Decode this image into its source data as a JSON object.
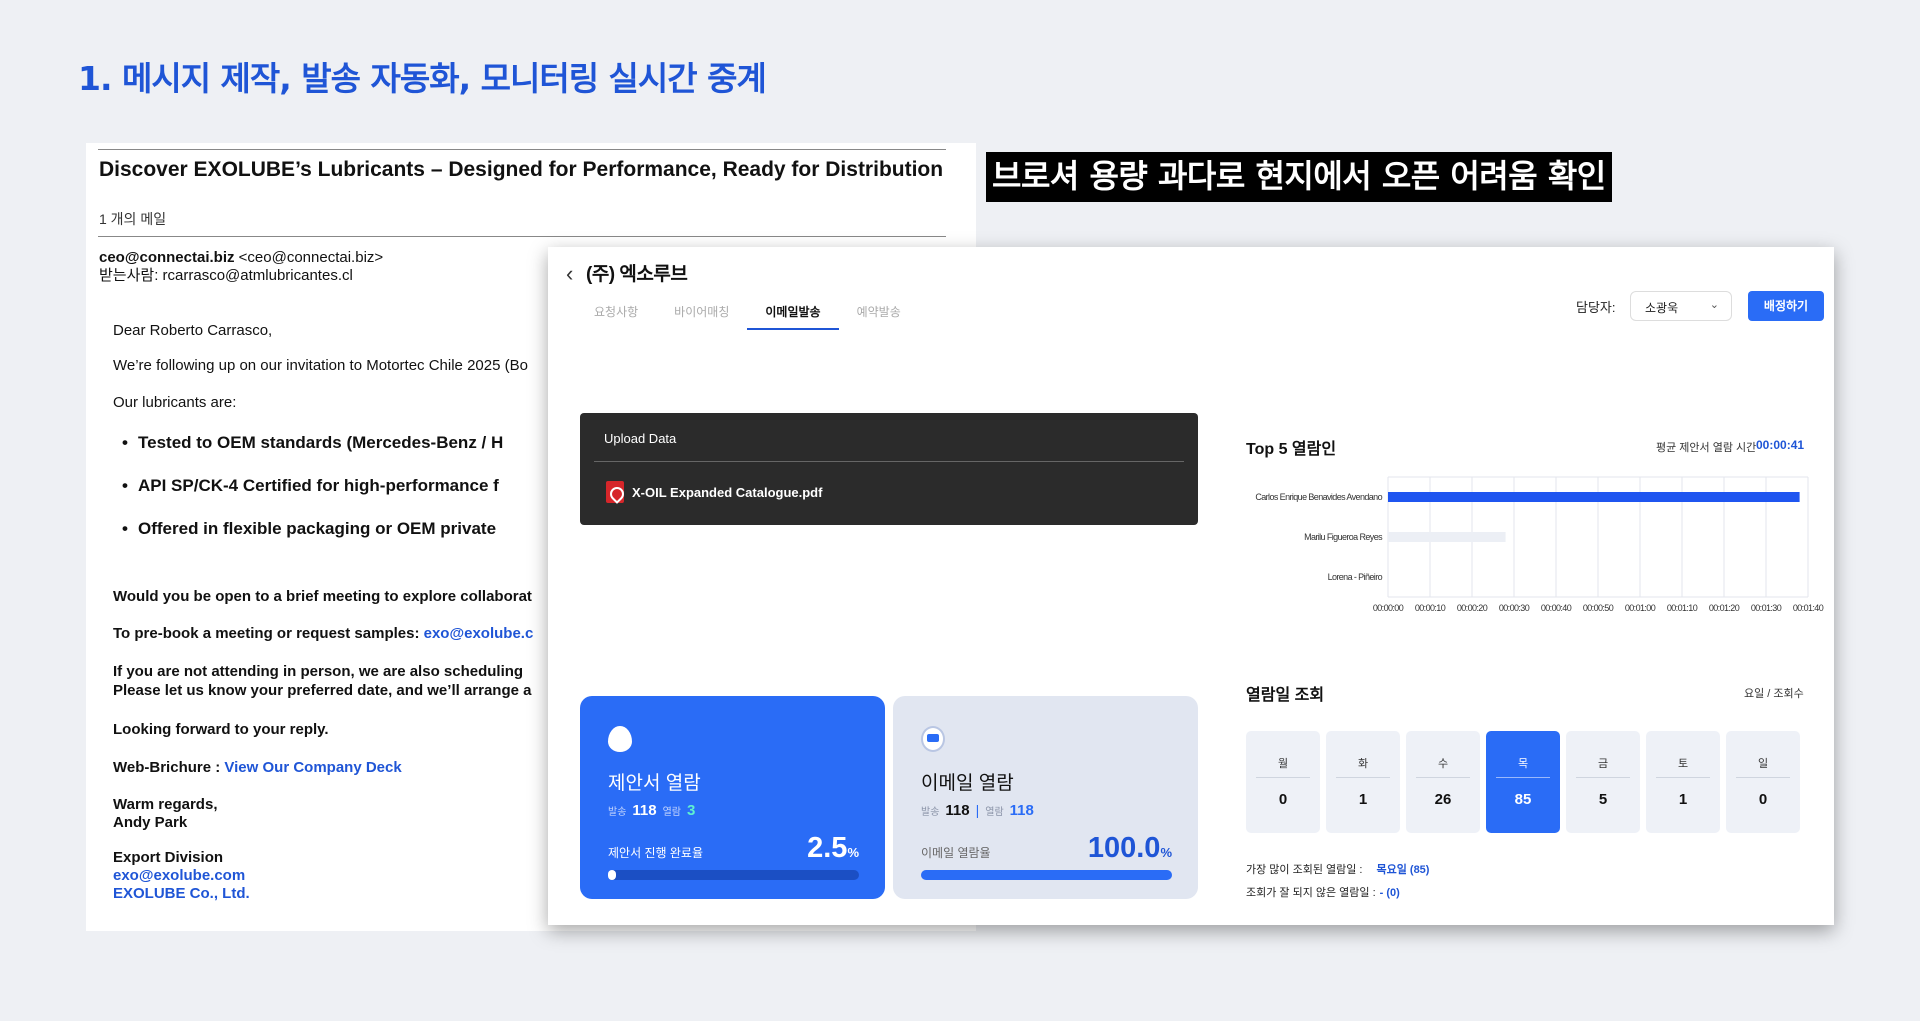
{
  "slide": {
    "title": "1. 메시지 제작, 발송 자동화, 모니터링 실시간 중계",
    "caption": "브로셔 용량 과다로 현지에서 오픈 어려움 확인"
  },
  "email": {
    "subject": "Discover EXOLUBE’s Lubricants – Designed for Performance, Ready for Distribution",
    "count": "1 개의 메일",
    "from_name": "ceo@connectai.biz",
    "from_addr": "<ceo@connectai.biz>",
    "to": "받는사람: rcarrasco@atmlubricantes.cl",
    "greeting": "Dear Roberto Carrasco,",
    "intro": "We’re following up on our invitation to Motortec Chile 2025 (Bo",
    "lead": "Our lubricants are:",
    "bullets": [
      "Tested to OEM standards (Mercedes-Benz / H",
      "API SP/CK-4 Certified for high-performance f",
      "Offered in flexible packaging or OEM private"
    ],
    "q1": "Would you be open to a brief meeting to explore collaborat",
    "q2_label": "To pre-book a meeting or request samples:",
    "q2_link": "exo@exolube.c",
    "q3_line1": "If you are not attending in person, we are also scheduling",
    "q3_line2": "Please let us know your preferred date, and we’ll arrange a",
    "q4": "Looking forward to your reply.",
    "web_label": "Web-Brichure :",
    "web_link": "View Our Company Deck",
    "regards1": "Warm regards,",
    "regards2": "Andy Park",
    "sig_dept": "Export Division",
    "sig_email": "exo@exolube.com",
    "sig_company": "EXOLUBE Co., Ltd."
  },
  "dashboard": {
    "back_icon": "chevron-left-icon",
    "company": "(주) 엑소루브",
    "tabs": [
      "요청사항",
      "바이어매칭",
      "이메일발송",
      "예약발송"
    ],
    "active_tab": 2,
    "assignee_label": "담당자:",
    "assignee_value": "소광욱",
    "assign_button": "배정하기",
    "upload_title": "Upload Data",
    "upload_file": "X-OIL Expanded Catalogue.pdf",
    "top5_title": "Top 5 열람인",
    "avg_label": "평균 제안서 열람 시간",
    "avg_value": "00:00:41",
    "calendar_title": "열람일 조회",
    "calendar_unit": "요일 / 조회수",
    "days": [
      {
        "name": "월",
        "value": "0"
      },
      {
        "name": "화",
        "value": "1"
      },
      {
        "name": "수",
        "value": "26"
      },
      {
        "name": "목",
        "value": "85"
      },
      {
        "name": "금",
        "value": "5"
      },
      {
        "name": "토",
        "value": "1"
      },
      {
        "name": "일",
        "value": "0"
      }
    ],
    "highlight_day": 3,
    "most_viewed_label": "가장 많이 조회된 열람일 :",
    "most_viewed_value": "목요일 (85)",
    "least_viewed_label": "조회가 잘 되지 않은 열람일 :",
    "least_viewed_value": "- (0)",
    "proposal_card": {
      "title": "제안서 열람",
      "sent_label": "발송",
      "sent_value": "118",
      "open_label": "열람",
      "open_value": "3",
      "rate_label": "제안서 진행 완료율",
      "rate_value": "2.5",
      "rate_unit": "%",
      "progress": 2.5
    },
    "email_card": {
      "title": "이메일 열람",
      "sent_label": "발송",
      "sent_value": "118",
      "sep": "|",
      "open_label": "열람",
      "open_value": "118",
      "rate_label": "이메일 열람율",
      "rate_value": "100.0",
      "rate_unit": "%",
      "progress": 100
    }
  },
  "chart_data": {
    "type": "bar",
    "orientation": "horizontal",
    "categories": [
      "Carlos Enrique Benavides Avendano",
      "Marilu Figueroa Reyes",
      "Lorena - Piñeiro"
    ],
    "values": [
      98,
      28,
      0
    ],
    "value_unit": "seconds",
    "x_ticks": [
      "00:00:00",
      "00:00:10",
      "00:00:20",
      "00:00:30",
      "00:00:40",
      "00:00:50",
      "00:01:00",
      "00:01:10",
      "00:01:20",
      "00:01:30",
      "00:01:40"
    ],
    "xlim": [
      0,
      100
    ],
    "grid": true,
    "colors": [
      "#1f55f0",
      "#eceff5",
      "#eceff5"
    ]
  }
}
